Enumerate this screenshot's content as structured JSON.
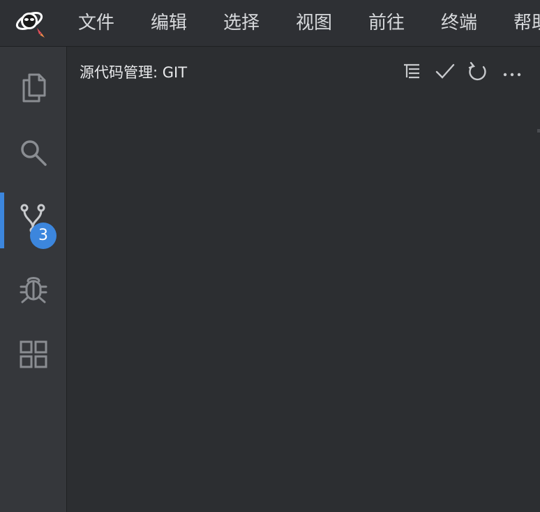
{
  "menubar": {
    "items": [
      "文件",
      "编辑",
      "选择",
      "视图",
      "前往",
      "终端",
      "帮助"
    ]
  },
  "activity_bar": {
    "items": [
      {
        "name": "explorer",
        "icon": "files-icon"
      },
      {
        "name": "search",
        "icon": "search-icon"
      },
      {
        "name": "source-control",
        "icon": "source-control-icon",
        "active": true,
        "badge": "3"
      },
      {
        "name": "debug",
        "icon": "bug-icon"
      },
      {
        "name": "extensions",
        "icon": "extensions-icon"
      }
    ]
  },
  "sidebar": {
    "title": "源代码管理: GIT",
    "actions": [
      {
        "name": "view-as-tree",
        "icon": "list-tree-icon"
      },
      {
        "name": "commit",
        "icon": "check-icon"
      },
      {
        "name": "refresh",
        "icon": "refresh-icon"
      },
      {
        "name": "more-actions",
        "icon": "ellipsis-icon"
      }
    ]
  },
  "colors": {
    "accent": "#3c86dd",
    "menubar_bg": "#2e3034",
    "activitybar_bg": "#35373b",
    "sidebar_bg": "#2c2e31",
    "icon": "#8a8d92",
    "text": "#e9eaec"
  }
}
